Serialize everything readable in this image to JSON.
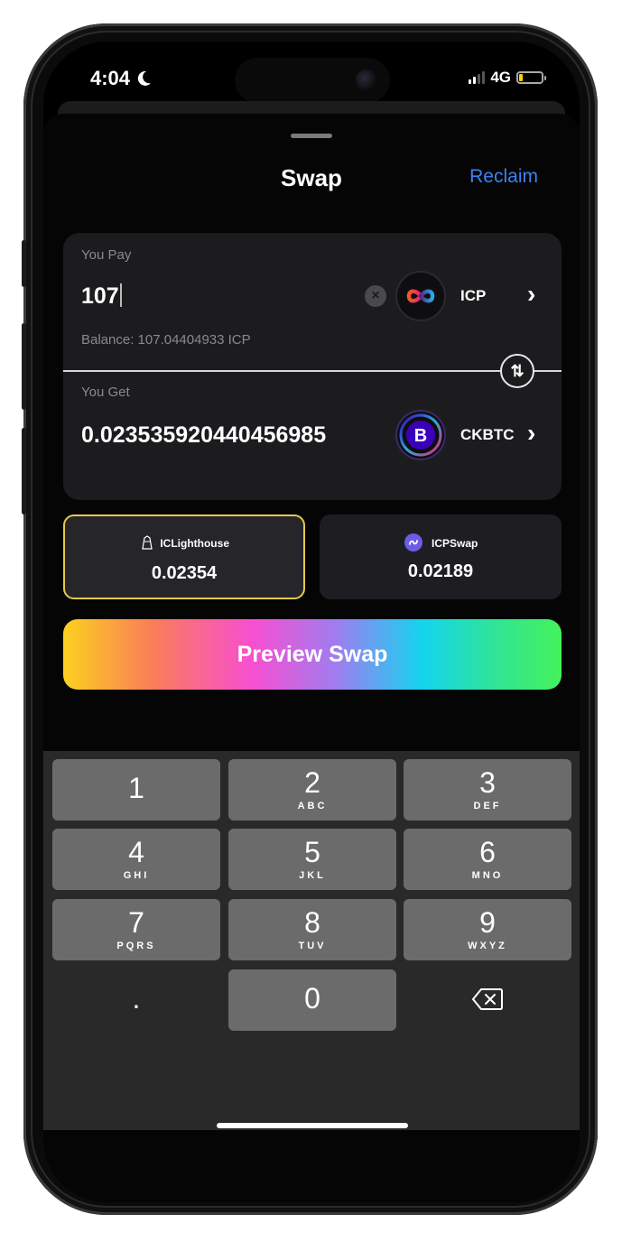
{
  "status": {
    "time": "4:04",
    "network": "4G"
  },
  "sheet": {
    "title": "Swap",
    "reclaim": "Reclaim"
  },
  "pay": {
    "label": "You Pay",
    "amount": "107",
    "token": "ICP",
    "balance": "Balance: 107.04404933 ICP"
  },
  "get": {
    "label": "You Get",
    "amount": "0.023535920440456985",
    "token": "CKBTC"
  },
  "quotes": [
    {
      "provider": "ICLighthouse",
      "value": "0.02354",
      "selected": true
    },
    {
      "provider": "ICPSwap",
      "value": "0.02189",
      "selected": false
    }
  ],
  "preview_button": "Preview Swap",
  "keypad": {
    "k1": {
      "digit": "1",
      "letters": ""
    },
    "k2": {
      "digit": "2",
      "letters": "ABC"
    },
    "k3": {
      "digit": "3",
      "letters": "DEF"
    },
    "k4": {
      "digit": "4",
      "letters": "GHI"
    },
    "k5": {
      "digit": "5",
      "letters": "JKL"
    },
    "k6": {
      "digit": "6",
      "letters": "MNO"
    },
    "k7": {
      "digit": "7",
      "letters": "PQRS"
    },
    "k8": {
      "digit": "8",
      "letters": "TUV"
    },
    "k9": {
      "digit": "9",
      "letters": "WXYZ"
    },
    "dot": ".",
    "k0": {
      "digit": "0"
    }
  },
  "colors": {
    "accent": "#3b82f6",
    "selected_border": "#e6c84a",
    "battery": "#f5d10e"
  }
}
